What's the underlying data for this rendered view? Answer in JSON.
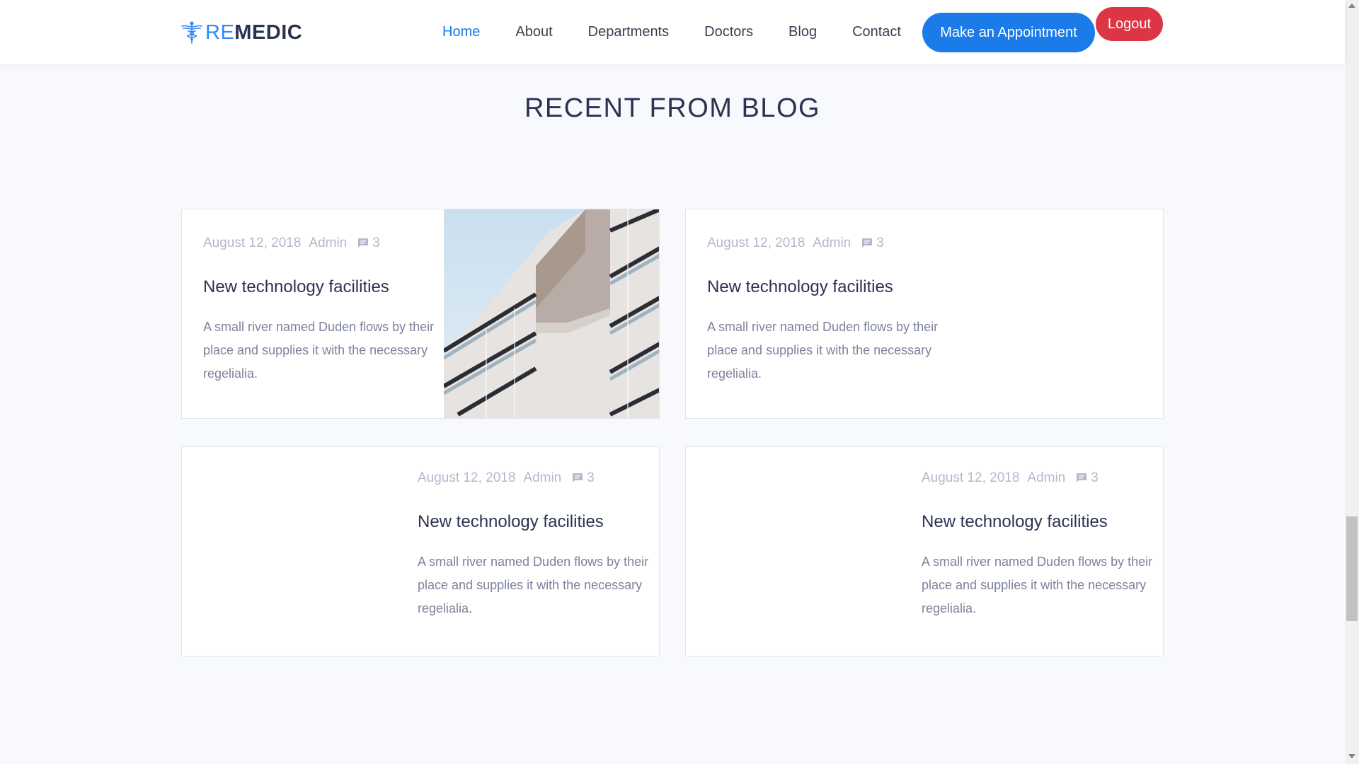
{
  "brand": {
    "part1": "RE",
    "part2": "MEDIC",
    "icon": "caduceus-icon",
    "accent_color": "#2f89fc"
  },
  "nav": {
    "items": [
      {
        "label": "Home",
        "active": true
      },
      {
        "label": "About",
        "active": false
      },
      {
        "label": "Departments",
        "active": false
      },
      {
        "label": "Doctors",
        "active": false
      },
      {
        "label": "Blog",
        "active": false
      },
      {
        "label": "Contact",
        "active": false
      }
    ],
    "appointment_label": "Make an Appointment",
    "logout_label": "Logout",
    "appointment_color": "#1a7be9",
    "logout_color": "#dc3545"
  },
  "section": {
    "title": "RECENT FROM BLOG"
  },
  "posts": [
    {
      "date": "August 12, 2018",
      "author": "Admin",
      "comments": "3",
      "comment_icon": "chat-bubble-icon",
      "title": "New technology facilities",
      "excerpt": "A small river named Duden flows by their place and supplies it with the necessary regelialia.",
      "has_image": true
    },
    {
      "date": "August 12, 2018",
      "author": "Admin",
      "comments": "3",
      "comment_icon": "chat-bubble-icon",
      "title": "New technology facilities",
      "excerpt": "A small river named Duden flows by their place and supplies it with the necessary regelialia.",
      "has_image": false
    },
    {
      "date": "August 12, 2018",
      "author": "Admin",
      "comments": "3",
      "comment_icon": "chat-bubble-icon",
      "title": "New technology facilities",
      "excerpt": "A small river named Duden flows by their place and supplies it with the necessary regelialia.",
      "has_image": false
    },
    {
      "date": "August 12, 2018",
      "author": "Admin",
      "comments": "3",
      "comment_icon": "chat-bubble-icon",
      "title": "New technology facilities",
      "excerpt": "A small river named Duden flows by their place and supplies it with the necessary regelialia.",
      "has_image": false
    }
  ]
}
